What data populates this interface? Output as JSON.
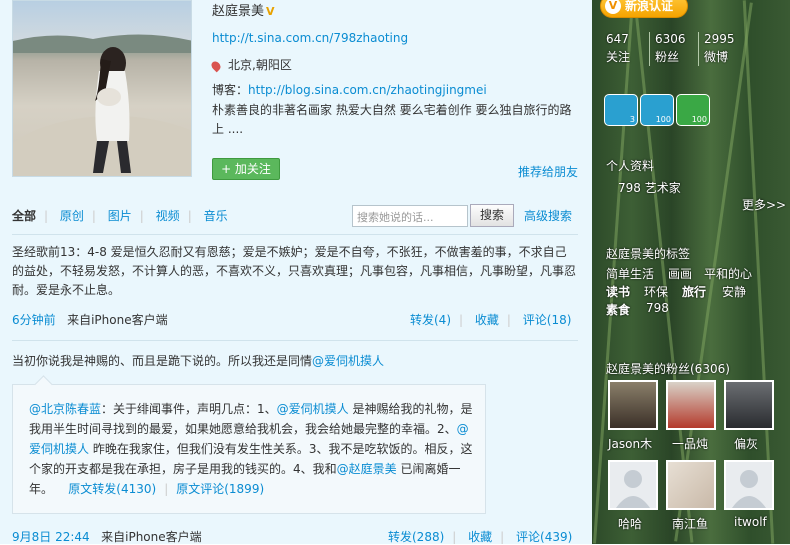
{
  "profile": {
    "name": "赵庭景美",
    "verified_mark": "V",
    "url": "http://t.sina.com.cn/798zhaoting",
    "location": "北京,朝阳区",
    "blog_label": "博客：",
    "blog_url": "http://blog.sina.com.cn/zhaotingjingmei",
    "bio": "朴素善良的非著名画家 热爱大自然 要么宅着创作 要么独自旅行的路上 ....",
    "follow_label": "+ 加关注",
    "recommend_label": "推荐给朋友"
  },
  "tabs": [
    "全部",
    "原创",
    "图片",
    "视频",
    "音乐"
  ],
  "search": {
    "placeholder": "搜索她说的话...",
    "button": "搜索",
    "advanced": "高级搜索"
  },
  "posts": [
    {
      "text": "圣经歌前13：4-8 爱是恒久忍耐又有恩慈；爱是不嫉妒；爱是不自夸，不张狂，不做害羞的事，不求自己的益处，不轻易发怒，不计算人的恶，不喜欢不义，只喜欢真理；凡事包容，凡事相信，凡事盼望，凡事忍耐。爱是永不止息。",
      "time": "6分钟前",
      "source": "来自iPhone客户端",
      "repost": "转发(4)",
      "fav": "收藏",
      "comment": "评论(18)"
    },
    {
      "text_prefix": "当初你说我是神赐的、而且是跪下说的。所以我还是同情",
      "text_mention": "@爱伺机摸人",
      "quote": {
        "author": "@北京陈春蓝",
        "p1": "：关于绯闻事件，声明几点：1、",
        "m1": "@爱伺机摸人",
        "p2": " 是神赐给我的礼物，是我用半生时间寻找到的最爱，如果她愿意给我机会，我会给她最完整的幸福。2、",
        "m2": "@爱伺机摸人",
        "p3": " 昨晚在我家住，但我们没有发生性关系。3、我不是吃软饭的。相反，这个家的开支都是我在承担，房子是用我的钱买的。4、我和",
        "m3": "@赵庭景美",
        "p4": " 已闹离婚一年。",
        "orig_repost": "原文转发(4130)",
        "orig_comment": "原文评论(1899)"
      },
      "time": "9月8日 22:44",
      "source": "来自iPhone客户端",
      "repost": "转发(288)",
      "fav": "收藏",
      "comment": "评论(439)"
    }
  ],
  "sidebar": {
    "badge": "新浪认证",
    "stats": [
      {
        "num": "647",
        "label": "关注"
      },
      {
        "num": "6306",
        "label": "粉丝"
      },
      {
        "num": "2995",
        "label": "微博"
      }
    ],
    "medals": [
      "3",
      "100",
      "100"
    ],
    "profile_title": "个人资料",
    "profile_value": "798 艺术家",
    "more": "更多>>",
    "tags_title": "赵庭景美的标签",
    "tags": [
      "简单生活",
      "画画",
      "平和的心",
      "读书",
      "环保",
      "旅行",
      "安静",
      "素食",
      "798"
    ],
    "fans_title": "赵庭景美的粉丝(6306)",
    "fans": [
      "Jason木",
      "一品炖",
      "偏灰",
      "哈哈",
      "南江鱼",
      "itwolf"
    ]
  }
}
